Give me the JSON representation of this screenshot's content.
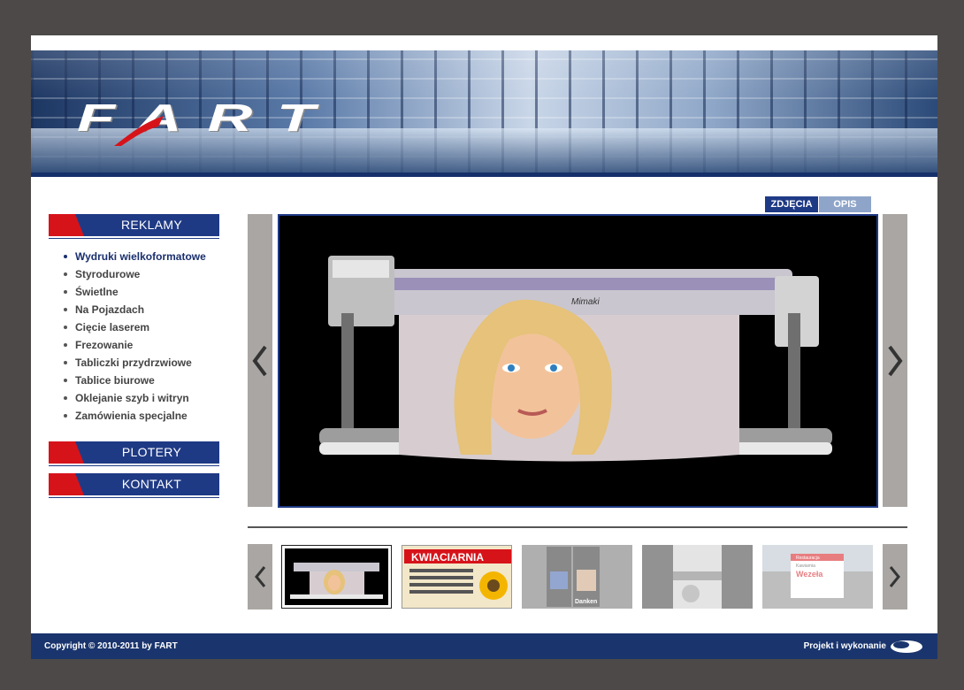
{
  "brand": {
    "logo_text": "FART"
  },
  "tabs": {
    "photos": "ZDJĘCIA",
    "description": "OPIS"
  },
  "menu": {
    "reklamy": "REKLAMY",
    "items": [
      {
        "label": "Wydruki wielkoformatowe",
        "active": true
      },
      {
        "label": "Styrodurowe"
      },
      {
        "label": "Świetlne"
      },
      {
        "label": "Na Pojazdach"
      },
      {
        "label": "Cięcie laserem"
      },
      {
        "label": "Frezowanie"
      },
      {
        "label": "Tabliczki przydrzwiowe"
      },
      {
        "label": "Tablice biurowe"
      },
      {
        "label": "Oklejanie szyb i witryn"
      },
      {
        "label": "Zamówienia specjalne"
      }
    ],
    "plotery": "PLOTERY",
    "kontakt": "KONTAKT"
  },
  "viewer": {
    "printer_brand": "Mimaki"
  },
  "thumbnails": {
    "kwiaciarnia_sign": "KWIACIARNIA",
    "banner_text": "Danken",
    "sign_line1": "Restauracja",
    "sign_line2": "Kawiarnia",
    "sign_name": "Wezeła"
  },
  "footer": {
    "copyright": "Copyright © 2010-2011 by FART",
    "credit": "Projekt i wykonanie"
  },
  "colors": {
    "navy": "#1f3a85",
    "red": "#d7131a",
    "frame": "#4d4949",
    "arrow_panel": "#aaa6a3"
  }
}
